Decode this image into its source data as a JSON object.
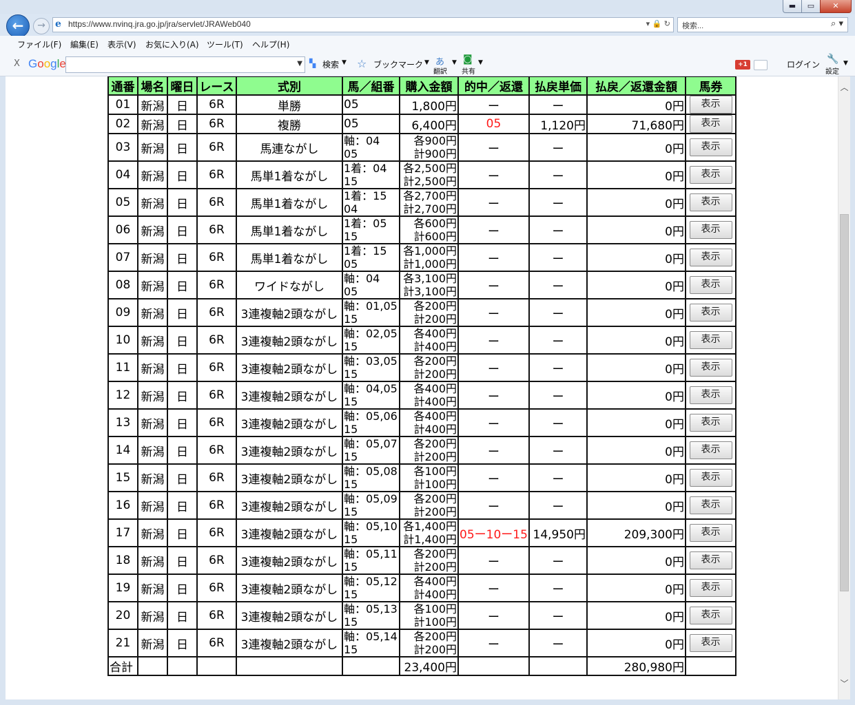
{
  "browser": {
    "window_controls": {
      "minimize": "▬",
      "maximize": "▭",
      "close": "✕"
    },
    "back_icon": "back-arrow-icon",
    "forward_icon": "forward-arrow-icon",
    "url": "https://www.nvinq.jra.go.jp/jra/servlet/JRAWeb040",
    "address_icons": "▾ 🔒 ↻",
    "search_placeholder": "検索...",
    "search_icon": "⌕ ▾",
    "menu": [
      "ファイル(F)",
      "編集(E)",
      "表示(V)",
      "お気に入り(A)",
      "ツール(T)",
      "ヘルプ(H)"
    ],
    "google_toolbar": {
      "close": "X",
      "logo": "Google",
      "search_btn": "検索",
      "bookmark": "ブックマーク",
      "translate": "翻訳",
      "share": "共有",
      "gplus": "+1",
      "login": "ログイン",
      "settings": "設定"
    }
  },
  "table": {
    "headers": [
      "通番",
      "場名",
      "曜日",
      "レース",
      "式別",
      "馬／組番",
      "購入金額",
      "的中／返還",
      "払戻単価",
      "払戻／返還金額",
      "馬券"
    ],
    "view_button": "表示",
    "rows": [
      {
        "no": "01",
        "venue": "新潟",
        "day": "日",
        "race": "6R",
        "type": "単勝",
        "combo1": "05",
        "combo2": "",
        "amt1": "1,800円",
        "amt2": "",
        "hit": "ー",
        "hit_red": false,
        "unit": "ー",
        "payout": "0円"
      },
      {
        "no": "02",
        "venue": "新潟",
        "day": "日",
        "race": "6R",
        "type": "複勝",
        "combo1": "05",
        "combo2": "",
        "amt1": "6,400円",
        "amt2": "",
        "hit": "05",
        "hit_red": true,
        "unit": "1,120円",
        "payout": "71,680円"
      },
      {
        "no": "03",
        "venue": "新潟",
        "day": "日",
        "race": "6R",
        "type": "馬連ながし",
        "combo1": "軸：04",
        "combo2": "05",
        "amt1": "各900円",
        "amt2": "計900円",
        "hit": "ー",
        "hit_red": false,
        "unit": "ー",
        "payout": "0円"
      },
      {
        "no": "04",
        "venue": "新潟",
        "day": "日",
        "race": "6R",
        "type": "馬単1着ながし",
        "combo1": "1着：04",
        "combo2": "15",
        "amt1": "各2,500円",
        "amt2": "計2,500円",
        "hit": "ー",
        "hit_red": false,
        "unit": "ー",
        "payout": "0円"
      },
      {
        "no": "05",
        "venue": "新潟",
        "day": "日",
        "race": "6R",
        "type": "馬単1着ながし",
        "combo1": "1着：15",
        "combo2": "04",
        "amt1": "各2,700円",
        "amt2": "計2,700円",
        "hit": "ー",
        "hit_red": false,
        "unit": "ー",
        "payout": "0円"
      },
      {
        "no": "06",
        "venue": "新潟",
        "day": "日",
        "race": "6R",
        "type": "馬単1着ながし",
        "combo1": "1着：05",
        "combo2": "15",
        "amt1": "各600円",
        "amt2": "計600円",
        "hit": "ー",
        "hit_red": false,
        "unit": "ー",
        "payout": "0円"
      },
      {
        "no": "07",
        "venue": "新潟",
        "day": "日",
        "race": "6R",
        "type": "馬単1着ながし",
        "combo1": "1着：15",
        "combo2": "05",
        "amt1": "各1,000円",
        "amt2": "計1,000円",
        "hit": "ー",
        "hit_red": false,
        "unit": "ー",
        "payout": "0円"
      },
      {
        "no": "08",
        "venue": "新潟",
        "day": "日",
        "race": "6R",
        "type": "ワイドながし",
        "combo1": "軸：04",
        "combo2": "05",
        "amt1": "各3,100円",
        "amt2": "計3,100円",
        "hit": "ー",
        "hit_red": false,
        "unit": "ー",
        "payout": "0円"
      },
      {
        "no": "09",
        "venue": "新潟",
        "day": "日",
        "race": "6R",
        "type": "3連複軸2頭ながし",
        "combo1": "軸：01,05",
        "combo2": "15",
        "amt1": "各200円",
        "amt2": "計200円",
        "hit": "ー",
        "hit_red": false,
        "unit": "ー",
        "payout": "0円"
      },
      {
        "no": "10",
        "venue": "新潟",
        "day": "日",
        "race": "6R",
        "type": "3連複軸2頭ながし",
        "combo1": "軸：02,05",
        "combo2": "15",
        "amt1": "各400円",
        "amt2": "計400円",
        "hit": "ー",
        "hit_red": false,
        "unit": "ー",
        "payout": "0円"
      },
      {
        "no": "11",
        "venue": "新潟",
        "day": "日",
        "race": "6R",
        "type": "3連複軸2頭ながし",
        "combo1": "軸：03,05",
        "combo2": "15",
        "amt1": "各200円",
        "amt2": "計200円",
        "hit": "ー",
        "hit_red": false,
        "unit": "ー",
        "payout": "0円"
      },
      {
        "no": "12",
        "venue": "新潟",
        "day": "日",
        "race": "6R",
        "type": "3連複軸2頭ながし",
        "combo1": "軸：04,05",
        "combo2": "15",
        "amt1": "各400円",
        "amt2": "計400円",
        "hit": "ー",
        "hit_red": false,
        "unit": "ー",
        "payout": "0円"
      },
      {
        "no": "13",
        "venue": "新潟",
        "day": "日",
        "race": "6R",
        "type": "3連複軸2頭ながし",
        "combo1": "軸：05,06",
        "combo2": "15",
        "amt1": "各400円",
        "amt2": "計400円",
        "hit": "ー",
        "hit_red": false,
        "unit": "ー",
        "payout": "0円"
      },
      {
        "no": "14",
        "venue": "新潟",
        "day": "日",
        "race": "6R",
        "type": "3連複軸2頭ながし",
        "combo1": "軸：05,07",
        "combo2": "15",
        "amt1": "各200円",
        "amt2": "計200円",
        "hit": "ー",
        "hit_red": false,
        "unit": "ー",
        "payout": "0円"
      },
      {
        "no": "15",
        "venue": "新潟",
        "day": "日",
        "race": "6R",
        "type": "3連複軸2頭ながし",
        "combo1": "軸：05,08",
        "combo2": "15",
        "amt1": "各100円",
        "amt2": "計100円",
        "hit": "ー",
        "hit_red": false,
        "unit": "ー",
        "payout": "0円"
      },
      {
        "no": "16",
        "venue": "新潟",
        "day": "日",
        "race": "6R",
        "type": "3連複軸2頭ながし",
        "combo1": "軸：05,09",
        "combo2": "15",
        "amt1": "各200円",
        "amt2": "計200円",
        "hit": "ー",
        "hit_red": false,
        "unit": "ー",
        "payout": "0円"
      },
      {
        "no": "17",
        "venue": "新潟",
        "day": "日",
        "race": "6R",
        "type": "3連複軸2頭ながし",
        "combo1": "軸：05,10",
        "combo2": "15",
        "amt1": "各1,400円",
        "amt2": "計1,400円",
        "hit": "05ー10ー15",
        "hit_red": true,
        "unit": "14,950円",
        "payout": "209,300円"
      },
      {
        "no": "18",
        "venue": "新潟",
        "day": "日",
        "race": "6R",
        "type": "3連複軸2頭ながし",
        "combo1": "軸：05,11",
        "combo2": "15",
        "amt1": "各200円",
        "amt2": "計200円",
        "hit": "ー",
        "hit_red": false,
        "unit": "ー",
        "payout": "0円"
      },
      {
        "no": "19",
        "venue": "新潟",
        "day": "日",
        "race": "6R",
        "type": "3連複軸2頭ながし",
        "combo1": "軸：05,12",
        "combo2": "15",
        "amt1": "各400円",
        "amt2": "計400円",
        "hit": "ー",
        "hit_red": false,
        "unit": "ー",
        "payout": "0円"
      },
      {
        "no": "20",
        "venue": "新潟",
        "day": "日",
        "race": "6R",
        "type": "3連複軸2頭ながし",
        "combo1": "軸：05,13",
        "combo2": "15",
        "amt1": "各100円",
        "amt2": "計100円",
        "hit": "ー",
        "hit_red": false,
        "unit": "ー",
        "payout": "0円"
      },
      {
        "no": "21",
        "venue": "新潟",
        "day": "日",
        "race": "6R",
        "type": "3連複軸2頭ながし",
        "combo1": "軸：05,14",
        "combo2": "15",
        "amt1": "各200円",
        "amt2": "計200円",
        "hit": "ー",
        "hit_red": false,
        "unit": "ー",
        "payout": "0円"
      }
    ],
    "total": {
      "label": "合計",
      "purchase": "23,400円",
      "payout": "280,980円"
    }
  },
  "colors": {
    "header_bg": "#8ffc8f",
    "hit_red": "#ff1a1a"
  }
}
